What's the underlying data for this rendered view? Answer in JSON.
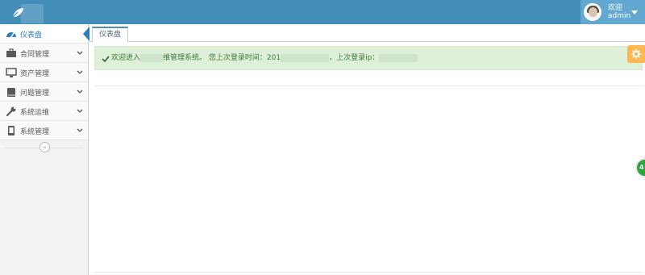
{
  "header": {
    "user_greeting": "欢迎",
    "user_name": "admin"
  },
  "sidebar": {
    "items": [
      {
        "label": "仪表盘",
        "icon": "dashboard-icon"
      },
      {
        "label": "合同管理",
        "icon": "briefcase-icon"
      },
      {
        "label": "资产管理",
        "icon": "monitor-icon"
      },
      {
        "label": "问题管理",
        "icon": "book-icon"
      },
      {
        "label": "系统运维",
        "icon": "wrench-icon"
      },
      {
        "label": "系统管理",
        "icon": "mobile-icon"
      }
    ],
    "collapse_label": "«"
  },
  "tabs": {
    "active": "仪表盘"
  },
  "alert": {
    "part1": "欢迎进入",
    "part2": "维管理系统。  您上次登录时间：201",
    "part3": "，上次登录ip："
  },
  "floating": {
    "green_badge": "4"
  },
  "colors": {
    "navbar": "#438eb9",
    "accent": "#2b7dbc",
    "alert_bg": "#dff0d8",
    "alert_text": "#3c763d",
    "settings": "#ffb752"
  }
}
